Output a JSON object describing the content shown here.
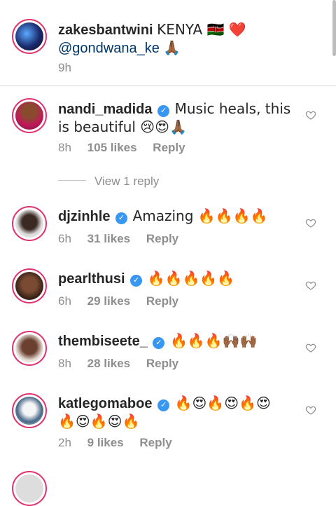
{
  "caption": {
    "username": "zakesbantwini",
    "text": "KENYA 🇰🇪 ❤️",
    "mention": "@gondwana_ke",
    "mention_emoji": "🙏🏾",
    "time": "9h"
  },
  "view_replies": "View 1 reply",
  "comments": [
    {
      "username": "nandi_madida",
      "line1": "Music heals, this",
      "line2": "is beautiful 😢😍🙏🏾",
      "time": "8h",
      "likes": "105 likes",
      "reply": "Reply"
    },
    {
      "username": "djzinhle",
      "line1": "Amazing 🔥🔥🔥🔥",
      "line2": "",
      "time": "6h",
      "likes": "31 likes",
      "reply": "Reply"
    },
    {
      "username": "pearlthusi",
      "line1": "🔥🔥🔥🔥🔥",
      "line2": "",
      "time": "6h",
      "likes": "29 likes",
      "reply": "Reply"
    },
    {
      "username": "thembiseete_",
      "line1": "🔥🔥🔥🙌🏾🙌🏾",
      "line2": "",
      "time": "8h",
      "likes": "28 likes",
      "reply": "Reply"
    },
    {
      "username": "katlegomaboe",
      "line1": "🔥😍🔥😍🔥😍",
      "line2": "🔥😍🔥😍🔥",
      "time": "2h",
      "likes": "9 likes",
      "reply": "Reply"
    }
  ],
  "colors": {
    "story_ring": "#e1306c",
    "verified": "#3897f0",
    "meta": "#8e8e8e",
    "mention": "#00376b"
  },
  "icons": {
    "like": "heart-outline-icon",
    "verified": "verified-badge-icon"
  }
}
